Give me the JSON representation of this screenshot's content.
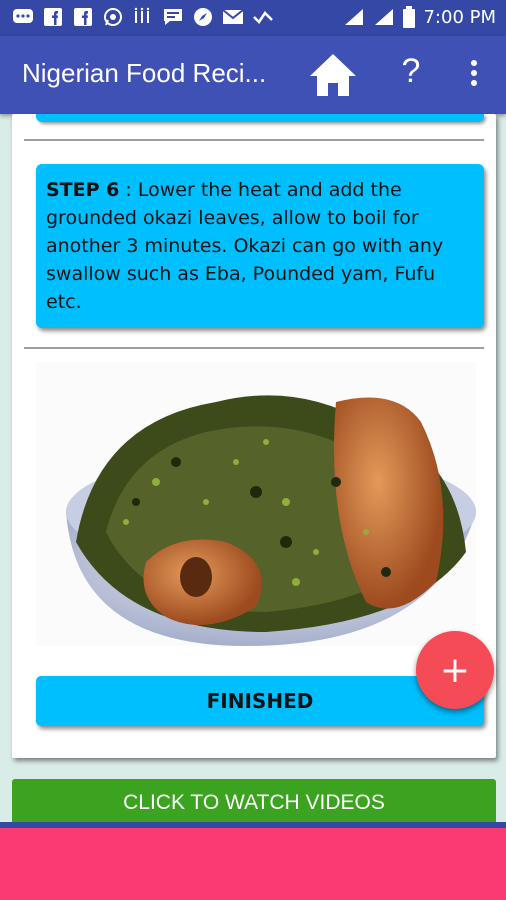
{
  "status_bar": {
    "time": "7:00 PM",
    "icons": [
      "messenger-icon",
      "facebook-icon",
      "facebook-icon",
      "whatsapp-icon",
      "jiji-icon",
      "chat-icon",
      "compass-icon",
      "mail-icon",
      "check-icon",
      "signal-icon",
      "signal-icon",
      "battery-icon"
    ]
  },
  "app_bar": {
    "title": "Nigerian Food Reci...",
    "help_label": "?",
    "actions": [
      "home-icon",
      "help-icon",
      "overflow-menu-icon"
    ]
  },
  "step": {
    "label": "STEP 6",
    "text": " : Lower the heat and add the grounded okazi leaves, allow to boil for another 3 minutes. Okazi can go with any swallow such as Eba, Pounded yam, Fufu etc."
  },
  "finished_label": "FINISHED",
  "fab_label": "+",
  "videos_label": "CLICK TO WATCH VIDEOS",
  "colors": {
    "app_bar": "#3f51b5",
    "step_box": "#00bfff",
    "fab": "#f44b56",
    "videos_button": "#3ba31f",
    "bottom_area": "#fb3a72"
  }
}
